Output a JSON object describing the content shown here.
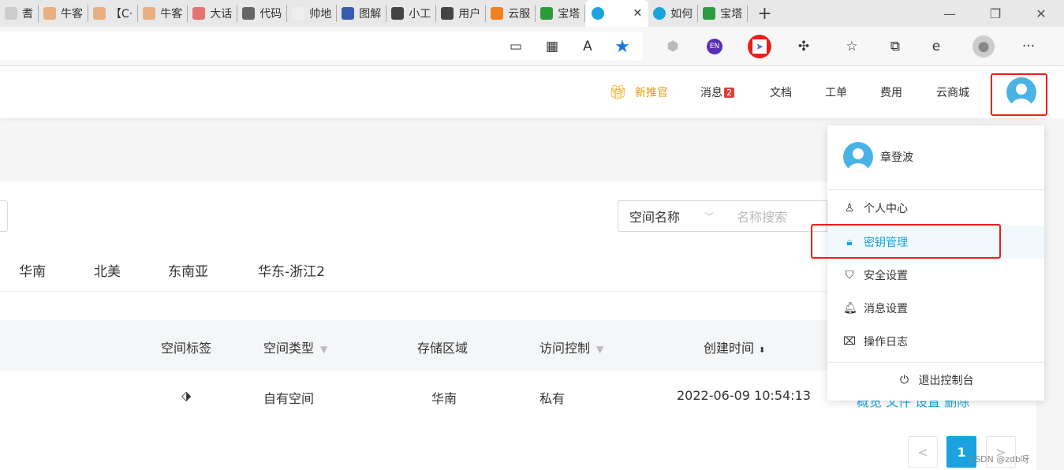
{
  "browser": {
    "tabs": [
      {
        "label": "耆",
        "color": "#ccc"
      },
      {
        "label": "牛客",
        "color": "#e8b080"
      },
      {
        "label": "【C·",
        "color": "#e8b080"
      },
      {
        "label": "牛客",
        "color": "#e8b080"
      },
      {
        "label": "大话",
        "color": "#e57373"
      },
      {
        "label": "代码",
        "color": "#666"
      },
      {
        "label": "帅地",
        "color": "#eee"
      },
      {
        "label": "图解",
        "color": "#3a5ab0"
      },
      {
        "label": "小工",
        "color": "#444"
      },
      {
        "label": "用户",
        "color": "#444"
      },
      {
        "label": "云服",
        "color": "#f08020"
      },
      {
        "label": "宝塔",
        "color": "#2e9a3e"
      },
      {
        "label": "",
        "color": "#1aa3e0",
        "active": true
      },
      {
        "label": "如何",
        "color": "#1aa3e0"
      },
      {
        "label": "宝塔",
        "color": "#2e9a3e"
      }
    ],
    "new_tab": "+",
    "close_tab": "✕",
    "window": {
      "minimize": "—",
      "restore": "❐",
      "close": "✕"
    },
    "toolbar_icons": [
      "app-icon",
      "apps-icon",
      "read-aloud-icon",
      "favorite-star-icon",
      "extension-shield-icon",
      "translate-en-icon",
      "extension-bird-icon",
      "extensions-icon",
      "favorites-icon",
      "collections-icon",
      "ie-mode-icon",
      "profile-icon",
      "more-icon"
    ],
    "read_aloud": "A",
    "en": "EN",
    "more": "···"
  },
  "header": {
    "promo": "新推官",
    "messages": "消息",
    "message_count": "2",
    "docs": "文档",
    "tickets": "工单",
    "billing": "费用",
    "store": "云商城"
  },
  "toolbar": {
    "select_value": "空间名称",
    "search_placeholder": "名称搜索"
  },
  "regions": [
    "华南",
    "北美",
    "东南亚",
    "华东-浙江2"
  ],
  "table": {
    "headers": [
      "空间标签",
      "空间类型",
      "存储区域",
      "访问控制",
      "创建时间"
    ],
    "row": {
      "type": "自有空间",
      "region": "华南",
      "access": "私有",
      "created": "2022-06-09 10:54:13",
      "actions": "概览 文件 设置 删除"
    }
  },
  "pagination": {
    "prev": "<",
    "current": "1",
    "next": ">"
  },
  "dropdown": {
    "username": "章登波",
    "items": [
      "个人中心",
      "密钥管理",
      "安全设置",
      "消息设置",
      "操作日志"
    ],
    "logout": "退出控制台"
  },
  "colors": {
    "accent": "#1aa3e0",
    "highlight": "#e8201a",
    "promo": "#f5a623"
  },
  "watermark": "CSDN @zdb呀"
}
